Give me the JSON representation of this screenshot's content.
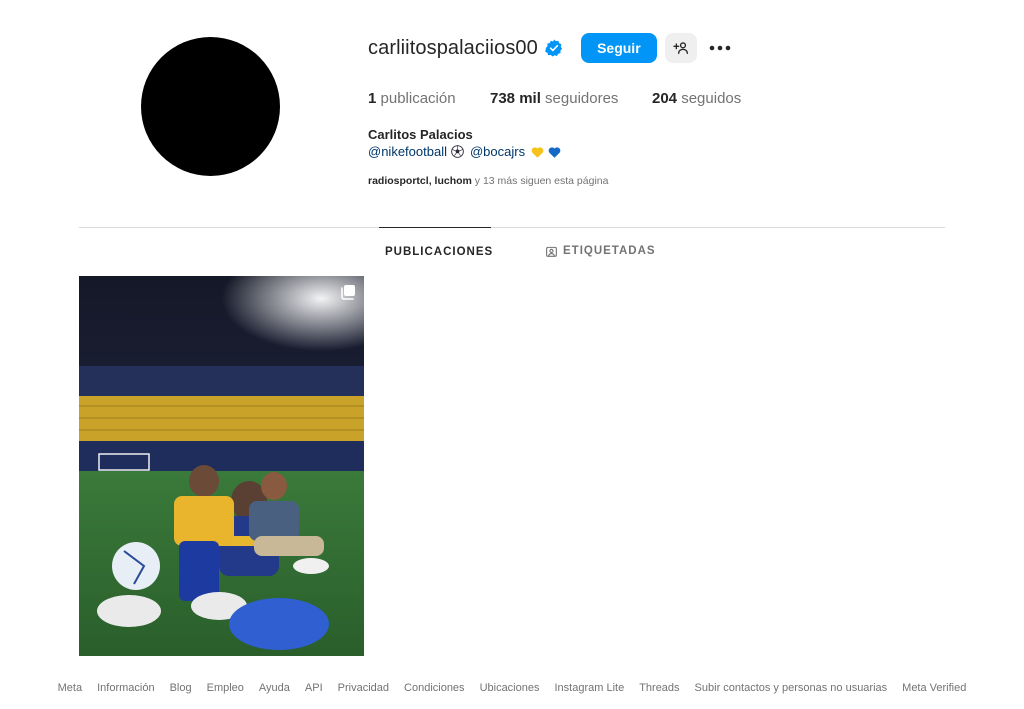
{
  "profile": {
    "username": "carliitospalaciios00",
    "follow_label": "Seguir",
    "full_name": "Carlitos Palacios",
    "bio_mention_1": "@nikefootball",
    "bio_mention_2": "@bocajrs",
    "posts_count": "1",
    "posts_label": "publicación",
    "followers_count": "738 mil",
    "followers_label": "seguidores",
    "following_count": "204",
    "following_label": "seguidos",
    "followed_by_user_1": "radiosportcl",
    "followed_by_user_2": "luchom",
    "followed_by_rest": "y 13 más siguen esta página"
  },
  "tabs": {
    "posts": "PUBLICACIONES",
    "tagged": "ETIQUETADAS"
  },
  "footer": {
    "links": [
      "Meta",
      "Información",
      "Blog",
      "Empleo",
      "Ayuda",
      "API",
      "Privacidad",
      "Condiciones",
      "Ubicaciones",
      "Instagram Lite",
      "Threads",
      "Subir contactos y personas no usuarias",
      "Meta Verified"
    ]
  },
  "colors": {
    "accent": "#0095f6",
    "verified": "#0095f6",
    "link": "#00376b",
    "muted": "#737373"
  },
  "icons": {
    "verified": "verified-badge-icon",
    "suggest": "add-person-icon",
    "more": "more-options-icon",
    "grid": "grid-icon",
    "tagged": "tagged-icon",
    "multi": "carousel-icon"
  }
}
